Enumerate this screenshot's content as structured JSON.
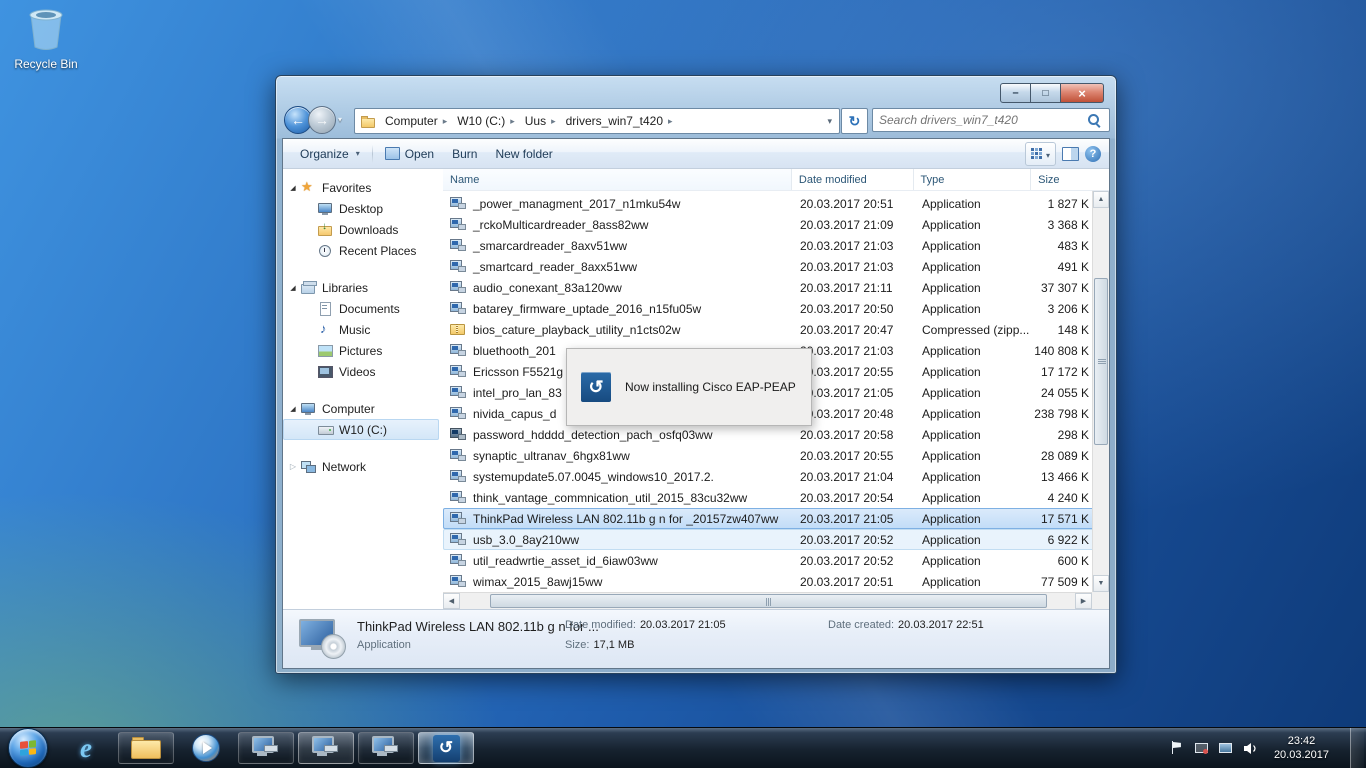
{
  "desktop": {
    "recycle_bin_label": "Recycle Bin"
  },
  "window": {
    "breadcrumb": {
      "segments": [
        {
          "label": "Computer"
        },
        {
          "label": "W10 (C:)"
        },
        {
          "label": "Uus"
        },
        {
          "label": "drivers_win7_t420"
        }
      ]
    },
    "search": {
      "placeholder": "Search drivers_win7_t420"
    },
    "toolbar": {
      "organize": "Organize",
      "open": "Open",
      "burn": "Burn",
      "new_folder": "New folder"
    },
    "sidebar_items": [
      {
        "label": "Favorites",
        "icon": "star",
        "level": 0,
        "expander": "expanded"
      },
      {
        "label": "Desktop",
        "icon": "desktop",
        "level": 1
      },
      {
        "label": "Downloads",
        "icon": "downloads",
        "level": 1
      },
      {
        "label": "Recent Places",
        "icon": "recent",
        "level": 1
      },
      {
        "label": "Libraries",
        "icon": "library",
        "level": 0,
        "expander": "expanded"
      },
      {
        "label": "Documents",
        "icon": "documents",
        "level": 1
      },
      {
        "label": "Music",
        "icon": "music",
        "level": 1
      },
      {
        "label": "Pictures",
        "icon": "pictures",
        "level": 1
      },
      {
        "label": "Videos",
        "icon": "videos",
        "level": 1
      },
      {
        "label": "Computer",
        "icon": "computer",
        "level": 0,
        "expander": "expanded"
      },
      {
        "label": "W10 (C:)",
        "icon": "drive",
        "level": 1,
        "state": "selected"
      },
      {
        "label": "Network",
        "icon": "network",
        "level": 0,
        "expander": "collapsed"
      }
    ],
    "columns": [
      "Name",
      "Date modified",
      "Type",
      "Size"
    ],
    "files": [
      {
        "name": "_power_managment_2017_n1mku54w",
        "date": "20.03.2017 20:51",
        "type": "Application",
        "size": "1 827 K",
        "icon": "app"
      },
      {
        "name": "_rckoMulticardreader_8ass82ww",
        "date": "20.03.2017 21:09",
        "type": "Application",
        "size": "3 368 K",
        "icon": "app"
      },
      {
        "name": "_smarcardreader_8axv51ww",
        "date": "20.03.2017 21:03",
        "type": "Application",
        "size": "483 K",
        "icon": "app"
      },
      {
        "name": "_smartcard_reader_8axx51ww",
        "date": "20.03.2017 21:03",
        "type": "Application",
        "size": "491 K",
        "icon": "app"
      },
      {
        "name": "audio_conexant_83a120ww",
        "date": "20.03.2017 21:11",
        "type": "Application",
        "size": "37 307 K",
        "icon": "app"
      },
      {
        "name": "batarey_firmware_uptade_2016_n15fu05w",
        "date": "20.03.2017 20:50",
        "type": "Application",
        "size": "3 206 K",
        "icon": "app"
      },
      {
        "name": "bios_cature_playback_utility_n1cts02w",
        "date": "20.03.2017 20:47",
        "type": "Compressed (zipp...",
        "size": "148 K",
        "icon": "zip"
      },
      {
        "name": "bluethooth_201",
        "date": "20.03.2017 21:03",
        "type": "Application",
        "size": "140 808 K",
        "icon": "app"
      },
      {
        "name": "Ericsson F5521g",
        "date": "20.03.2017 20:55",
        "type": "Application",
        "size": "17 172 K",
        "icon": "app"
      },
      {
        "name": "intel_pro_lan_83",
        "date": "20.03.2017 21:05",
        "type": "Application",
        "size": "24 055 K",
        "icon": "app"
      },
      {
        "name": "nivida_capus_d",
        "date": "20.03.2017 20:48",
        "type": "Application",
        "size": "238 798 K",
        "icon": "app"
      },
      {
        "name": "password_hdddd_detection_pach_osfq03ww",
        "date": "20.03.2017 20:58",
        "type": "Application",
        "size": "298 K",
        "icon": "app2"
      },
      {
        "name": "synaptic_ultranav_6hgx81ww",
        "date": "20.03.2017 20:55",
        "type": "Application",
        "size": "28 089 K",
        "icon": "app"
      },
      {
        "name": "systemupdate5.07.0045_windows10_2017.2.",
        "date": "20.03.2017 21:04",
        "type": "Application",
        "size": "13 466 K",
        "icon": "app"
      },
      {
        "name": "think_vantage_commnication_util_2015_83cu32ww",
        "date": "20.03.2017 20:54",
        "type": "Application",
        "size": "4 240 K",
        "icon": "app"
      },
      {
        "name": "ThinkPad Wireless LAN  802.11b g n  for _20157zw407ww",
        "date": "20.03.2017 21:05",
        "type": "Application",
        "size": "17 571 K",
        "icon": "app",
        "state": "selected"
      },
      {
        "name": "usb_3.0_8ay210ww",
        "date": "20.03.2017 20:52",
        "type": "Application",
        "size": "6 922 K",
        "icon": "app",
        "state": "hover"
      },
      {
        "name": "util_readwrtie_asset_id_6iaw03ww",
        "date": "20.03.2017 20:52",
        "type": "Application",
        "size": "600 K",
        "icon": "app"
      },
      {
        "name": "wimax_2015_8awj15ww",
        "date": "20.03.2017 20:51",
        "type": "Application",
        "size": "77 509 K",
        "icon": "app"
      }
    ],
    "dialog": {
      "text": "Now installing Cisco EAP-PEAP"
    },
    "details": {
      "name": "ThinkPad Wireless LAN  802.11b g n  for ...",
      "type": "Application",
      "date_modified_label": "Date modified:",
      "date_modified": "20.03.2017 21:05",
      "size_label": "Size:",
      "size": "17,1 MB",
      "date_created_label": "Date created:",
      "date_created": "20.03.2017 22:51"
    }
  },
  "taskbar": {
    "clock_time": "23:42",
    "clock_date": "20.03.2017"
  }
}
